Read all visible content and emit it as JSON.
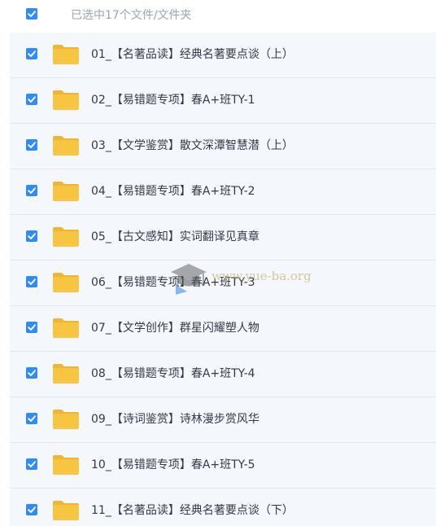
{
  "header": {
    "selection_text": "已选中17个文件/文件夹",
    "checked": true
  },
  "items": [
    {
      "name": "01_【名著品读】经典名著要点谈（上）",
      "type": "folder",
      "checked": true
    },
    {
      "name": "02_【易错题专项】春A+班TY-1",
      "type": "folder",
      "checked": true
    },
    {
      "name": "03_【文学鉴赏】散文深潭智慧潜（上）",
      "type": "folder",
      "checked": true
    },
    {
      "name": "04_【易错题专项】春A+班TY-2",
      "type": "folder",
      "checked": true
    },
    {
      "name": "05_【古文感知】实词翻译见真章",
      "type": "folder",
      "checked": true
    },
    {
      "name": "06_【易错题专项】春A+班TY-3",
      "type": "folder",
      "checked": true
    },
    {
      "name": "07_【文学创作】群星闪耀塑人物",
      "type": "folder",
      "checked": true
    },
    {
      "name": "08_【易错题专项】春A+班TY-4",
      "type": "folder",
      "checked": true
    },
    {
      "name": "09_【诗词鉴赏】诗林漫步赏风华",
      "type": "folder",
      "checked": true
    },
    {
      "name": "10_【易错题专项】春A+班TY-5",
      "type": "folder",
      "checked": true
    },
    {
      "name": "11_【名著品读】经典名著要点谈（下）",
      "type": "folder",
      "checked": true
    }
  ],
  "watermark": {
    "text": "www.yue-ba.org",
    "icon": "graduation-cap-icon"
  },
  "colors": {
    "checkbox": "#2f8cf2",
    "folder": "#f8c542",
    "folder_dark": "#eeb72e",
    "row_background": "#f4f8fd",
    "divider": "#dfe7f2",
    "text": "#333a44",
    "header_text": "#9aa4b3"
  }
}
